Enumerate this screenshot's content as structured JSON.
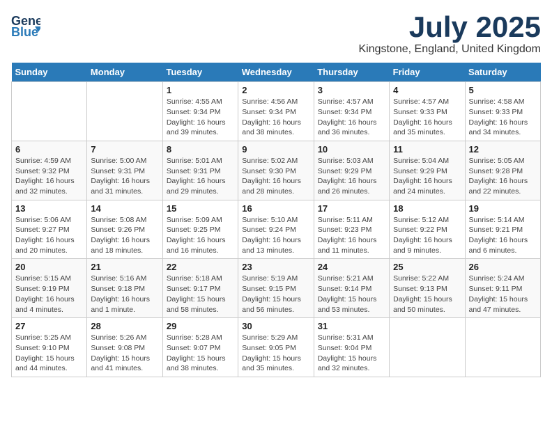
{
  "header": {
    "logo_line1": "General",
    "logo_line2": "Blue",
    "main_title": "July 2025",
    "subtitle": "Kingstone, England, United Kingdom"
  },
  "calendar": {
    "days_of_week": [
      "Sunday",
      "Monday",
      "Tuesday",
      "Wednesday",
      "Thursday",
      "Friday",
      "Saturday"
    ],
    "weeks": [
      [
        {
          "day": "",
          "info": ""
        },
        {
          "day": "",
          "info": ""
        },
        {
          "day": "1",
          "info": "Sunrise: 4:55 AM\nSunset: 9:34 PM\nDaylight: 16 hours and 39 minutes."
        },
        {
          "day": "2",
          "info": "Sunrise: 4:56 AM\nSunset: 9:34 PM\nDaylight: 16 hours and 38 minutes."
        },
        {
          "day": "3",
          "info": "Sunrise: 4:57 AM\nSunset: 9:34 PM\nDaylight: 16 hours and 36 minutes."
        },
        {
          "day": "4",
          "info": "Sunrise: 4:57 AM\nSunset: 9:33 PM\nDaylight: 16 hours and 35 minutes."
        },
        {
          "day": "5",
          "info": "Sunrise: 4:58 AM\nSunset: 9:33 PM\nDaylight: 16 hours and 34 minutes."
        }
      ],
      [
        {
          "day": "6",
          "info": "Sunrise: 4:59 AM\nSunset: 9:32 PM\nDaylight: 16 hours and 32 minutes."
        },
        {
          "day": "7",
          "info": "Sunrise: 5:00 AM\nSunset: 9:31 PM\nDaylight: 16 hours and 31 minutes."
        },
        {
          "day": "8",
          "info": "Sunrise: 5:01 AM\nSunset: 9:31 PM\nDaylight: 16 hours and 29 minutes."
        },
        {
          "day": "9",
          "info": "Sunrise: 5:02 AM\nSunset: 9:30 PM\nDaylight: 16 hours and 28 minutes."
        },
        {
          "day": "10",
          "info": "Sunrise: 5:03 AM\nSunset: 9:29 PM\nDaylight: 16 hours and 26 minutes."
        },
        {
          "day": "11",
          "info": "Sunrise: 5:04 AM\nSunset: 9:29 PM\nDaylight: 16 hours and 24 minutes."
        },
        {
          "day": "12",
          "info": "Sunrise: 5:05 AM\nSunset: 9:28 PM\nDaylight: 16 hours and 22 minutes."
        }
      ],
      [
        {
          "day": "13",
          "info": "Sunrise: 5:06 AM\nSunset: 9:27 PM\nDaylight: 16 hours and 20 minutes."
        },
        {
          "day": "14",
          "info": "Sunrise: 5:08 AM\nSunset: 9:26 PM\nDaylight: 16 hours and 18 minutes."
        },
        {
          "day": "15",
          "info": "Sunrise: 5:09 AM\nSunset: 9:25 PM\nDaylight: 16 hours and 16 minutes."
        },
        {
          "day": "16",
          "info": "Sunrise: 5:10 AM\nSunset: 9:24 PM\nDaylight: 16 hours and 13 minutes."
        },
        {
          "day": "17",
          "info": "Sunrise: 5:11 AM\nSunset: 9:23 PM\nDaylight: 16 hours and 11 minutes."
        },
        {
          "day": "18",
          "info": "Sunrise: 5:12 AM\nSunset: 9:22 PM\nDaylight: 16 hours and 9 minutes."
        },
        {
          "day": "19",
          "info": "Sunrise: 5:14 AM\nSunset: 9:21 PM\nDaylight: 16 hours and 6 minutes."
        }
      ],
      [
        {
          "day": "20",
          "info": "Sunrise: 5:15 AM\nSunset: 9:19 PM\nDaylight: 16 hours and 4 minutes."
        },
        {
          "day": "21",
          "info": "Sunrise: 5:16 AM\nSunset: 9:18 PM\nDaylight: 16 hours and 1 minute."
        },
        {
          "day": "22",
          "info": "Sunrise: 5:18 AM\nSunset: 9:17 PM\nDaylight: 15 hours and 58 minutes."
        },
        {
          "day": "23",
          "info": "Sunrise: 5:19 AM\nSunset: 9:15 PM\nDaylight: 15 hours and 56 minutes."
        },
        {
          "day": "24",
          "info": "Sunrise: 5:21 AM\nSunset: 9:14 PM\nDaylight: 15 hours and 53 minutes."
        },
        {
          "day": "25",
          "info": "Sunrise: 5:22 AM\nSunset: 9:13 PM\nDaylight: 15 hours and 50 minutes."
        },
        {
          "day": "26",
          "info": "Sunrise: 5:24 AM\nSunset: 9:11 PM\nDaylight: 15 hours and 47 minutes."
        }
      ],
      [
        {
          "day": "27",
          "info": "Sunrise: 5:25 AM\nSunset: 9:10 PM\nDaylight: 15 hours and 44 minutes."
        },
        {
          "day": "28",
          "info": "Sunrise: 5:26 AM\nSunset: 9:08 PM\nDaylight: 15 hours and 41 minutes."
        },
        {
          "day": "29",
          "info": "Sunrise: 5:28 AM\nSunset: 9:07 PM\nDaylight: 15 hours and 38 minutes."
        },
        {
          "day": "30",
          "info": "Sunrise: 5:29 AM\nSunset: 9:05 PM\nDaylight: 15 hours and 35 minutes."
        },
        {
          "day": "31",
          "info": "Sunrise: 5:31 AM\nSunset: 9:04 PM\nDaylight: 15 hours and 32 minutes."
        },
        {
          "day": "",
          "info": ""
        },
        {
          "day": "",
          "info": ""
        }
      ]
    ]
  }
}
